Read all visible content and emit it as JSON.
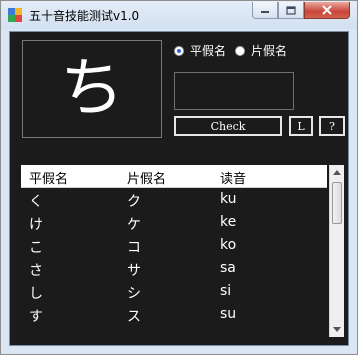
{
  "window": {
    "title": "五十音技能测试v1.0"
  },
  "kana_display": {
    "char": "ち"
  },
  "mode": {
    "hiragana_label": "平假名",
    "katakana_label": "片假名",
    "selected": "hiragana"
  },
  "answer": {
    "value": ""
  },
  "buttons": {
    "check": "Check",
    "l": "L",
    "help": "?"
  },
  "table": {
    "headers": [
      "平假名",
      "片假名",
      "读音"
    ],
    "rows": [
      [
        "く",
        "ク",
        "ku"
      ],
      [
        "け",
        "ケ",
        "ke"
      ],
      [
        "こ",
        "コ",
        "ko"
      ],
      [
        "さ",
        "サ",
        "sa"
      ],
      [
        "し",
        "シ",
        "si"
      ],
      [
        "す",
        "ス",
        "su"
      ]
    ]
  }
}
